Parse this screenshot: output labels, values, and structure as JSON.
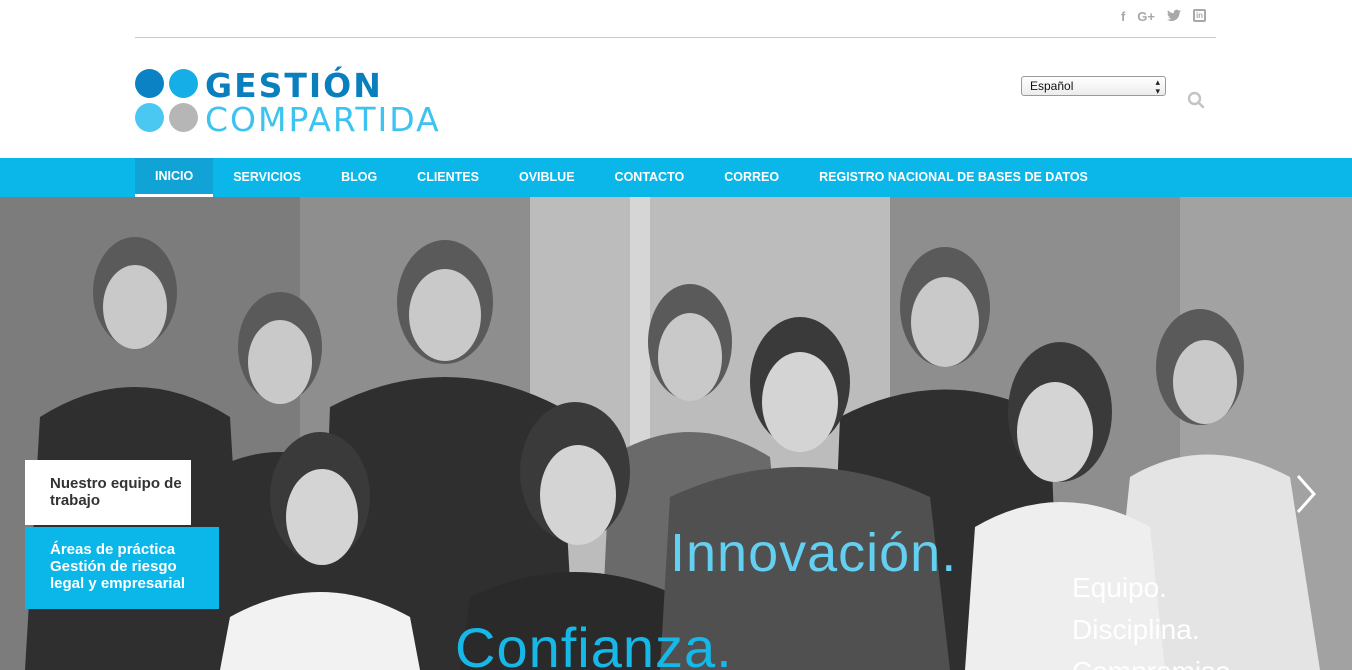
{
  "social": {
    "icons": [
      "facebook-icon",
      "google-plus-icon",
      "twitter-icon",
      "linkedin-icon"
    ],
    "facebook": "f",
    "googleplus": "G+",
    "linkedin": "in"
  },
  "logo": {
    "line1": "GESTIÓN",
    "line2": "COMPARTIDA",
    "colors": [
      "#0a82c4",
      "#16aee6",
      "#4ac8f2",
      "#b6b6b6"
    ]
  },
  "header": {
    "language_selected": "Español",
    "search_icon": "search-icon"
  },
  "nav": {
    "color": "#0bb6e9",
    "items": [
      {
        "label": "INICIO",
        "active": true
      },
      {
        "label": "SERVICIOS"
      },
      {
        "label": "BLOG"
      },
      {
        "label": "CLIENTES"
      },
      {
        "label": "OVIBLUE"
      },
      {
        "label": "CONTACTO"
      },
      {
        "label": "CORREO"
      },
      {
        "label": "REGISTRO NACIONAL DE BASES DE DATOS"
      }
    ]
  },
  "hero": {
    "card_team": "Nuestro equipo de trabajo",
    "card_areas_line1": "Áreas de práctica",
    "card_areas_line2": "Gestión de riesgo",
    "card_areas_line3": "legal y empresarial",
    "word_innovacion": "Innovación.",
    "word_confianza": "Confianza.",
    "word_equipo": "Equipo.",
    "word_disciplina": "Disciplina.",
    "word_compromiso": "Compromiso.",
    "next_icon": "chevron-right-icon"
  }
}
